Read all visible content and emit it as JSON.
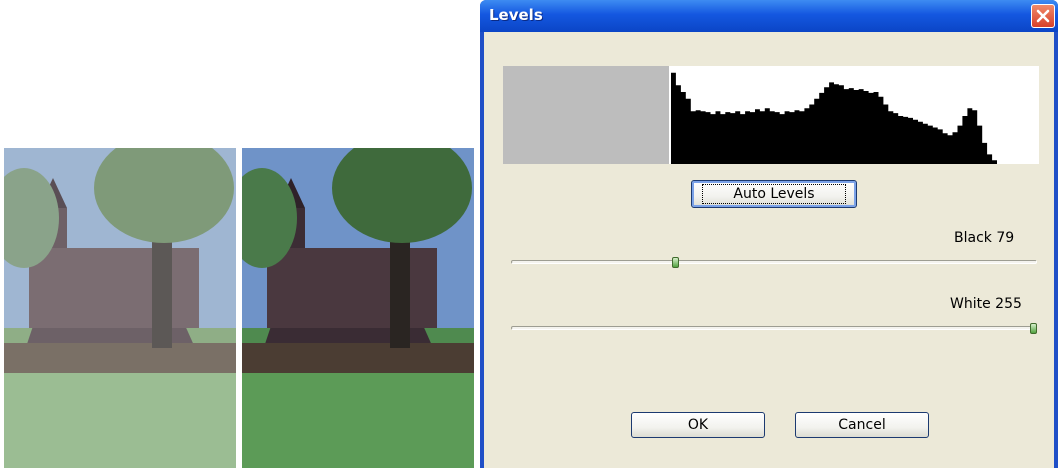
{
  "photos": {
    "before": {
      "name": "original-photo"
    },
    "after": {
      "name": "adjusted-photo"
    }
  },
  "dialog": {
    "title": "Levels",
    "close_icon": "close-icon",
    "auto_levels_label": "Auto Levels",
    "black": {
      "label": "Black 79",
      "value": 79,
      "min": 0,
      "max": 255
    },
    "white": {
      "label": "White 255",
      "value": 255,
      "min": 0,
      "max": 255
    },
    "ok_label": "OK",
    "cancel_label": "Cancel",
    "histogram": {
      "clipped_below": 79,
      "counts": [
        0.95,
        0.82,
        0.75,
        0.68,
        0.55,
        0.56,
        0.55,
        0.54,
        0.52,
        0.55,
        0.52,
        0.54,
        0.53,
        0.55,
        0.52,
        0.55,
        0.54,
        0.57,
        0.55,
        0.58,
        0.55,
        0.54,
        0.52,
        0.55,
        0.54,
        0.56,
        0.55,
        0.58,
        0.62,
        0.68,
        0.74,
        0.8,
        0.85,
        0.83,
        0.82,
        0.78,
        0.79,
        0.77,
        0.78,
        0.76,
        0.74,
        0.75,
        0.7,
        0.62,
        0.55,
        0.53,
        0.5,
        0.49,
        0.48,
        0.46,
        0.44,
        0.42,
        0.4,
        0.38,
        0.36,
        0.32,
        0.3,
        0.33,
        0.4,
        0.5,
        0.58,
        0.56,
        0.4,
        0.22,
        0.1,
        0.04
      ]
    },
    "colors": {
      "title_bar": "#0b45c6",
      "face": "#ece9d8",
      "clipped": "#bdbdbd",
      "histogram": "#000000"
    }
  }
}
